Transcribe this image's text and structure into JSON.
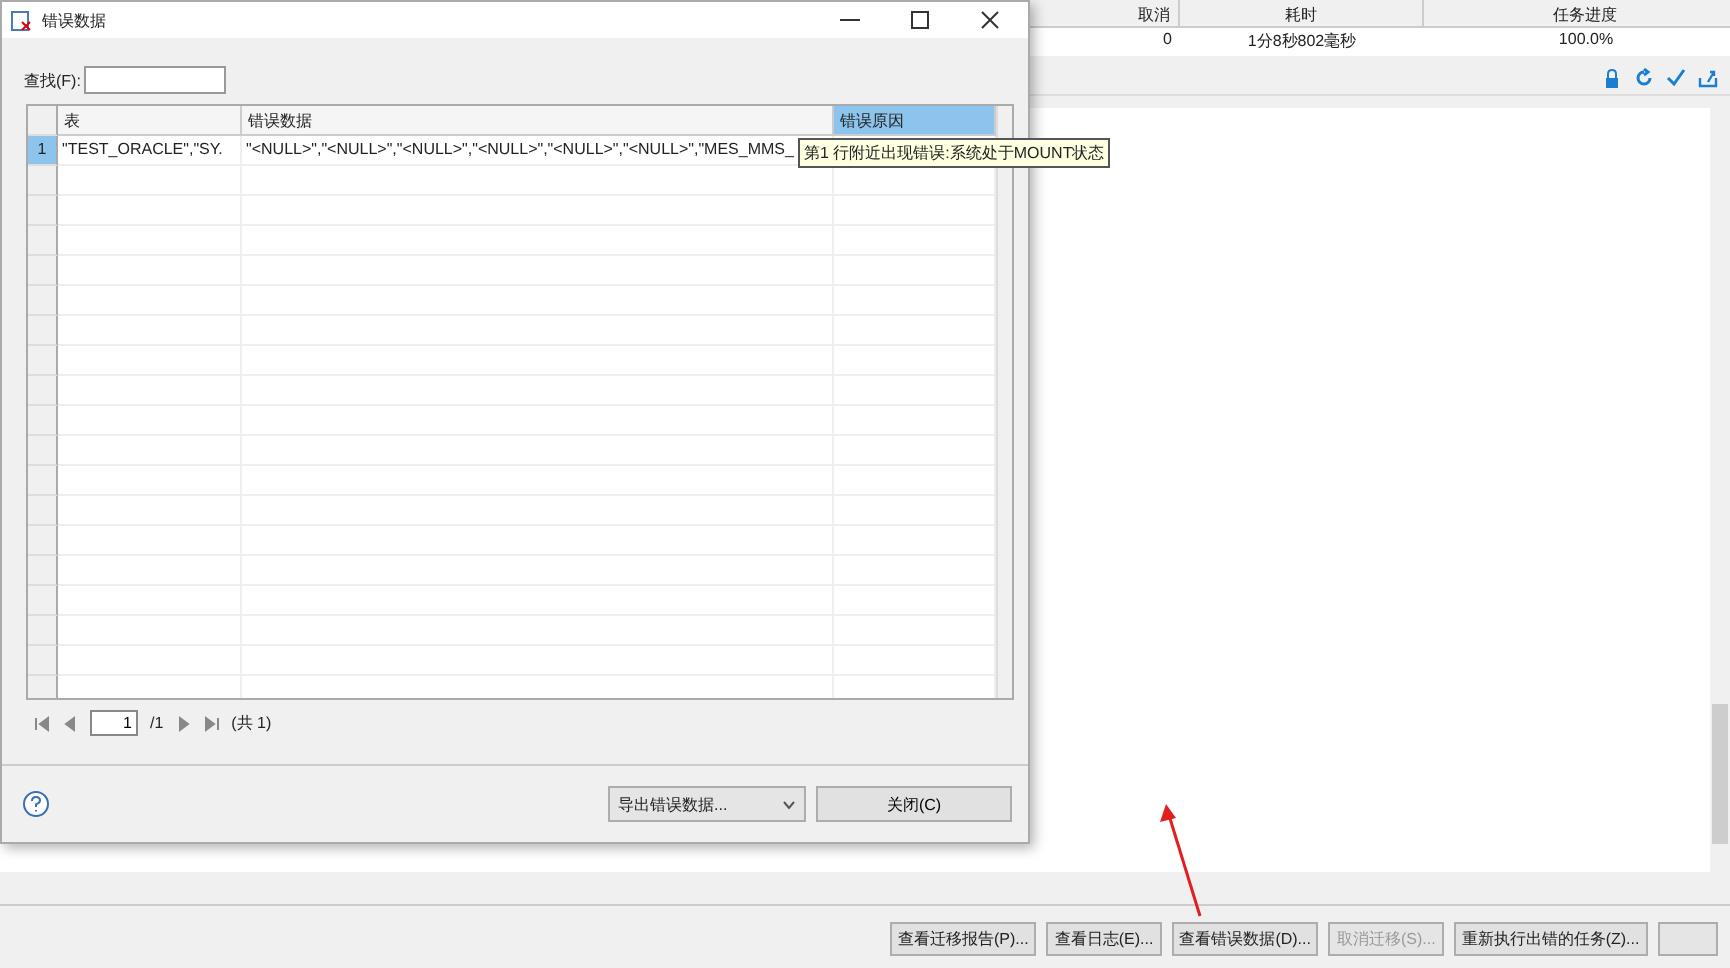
{
  "main_window": {
    "task_table": {
      "columns": [
        "取消",
        "耗时",
        "任务进度"
      ],
      "rows": [
        {
          "cells": [
            "0",
            "1分8秒802毫秒",
            "100.0%"
          ]
        }
      ]
    },
    "buttons": [
      {
        "label": "查看迁移报告(P)...",
        "disabled": false
      },
      {
        "label": "查看日志(E)...",
        "disabled": false
      },
      {
        "label": "查看错误数据(D)...",
        "disabled": false
      },
      {
        "label": "取消迁移(S)...",
        "disabled": true
      },
      {
        "label": "重新执行出错的任务(Z)...",
        "disabled": false
      }
    ]
  },
  "dialog": {
    "title": "错误数据",
    "find_label": "查找(F):",
    "grid": {
      "columns": [
        {
          "label": "表",
          "selected": false
        },
        {
          "label": "错误数据",
          "selected": false
        },
        {
          "label": "错误原因",
          "selected": true
        }
      ],
      "rows": [
        {
          "number": "1",
          "selected": true,
          "cells": [
            "\"TEST_ORACLE\",\"SY.",
            "\"<NULL>\",\"<NULL>\",\"<NULL>\",\"<NULL>\",\"<NULL>\",\"<NULL>\",\"MES_MMS_"
          ]
        }
      ],
      "tooltip": "第1 行附近出现错误:系统处于MOUNT状态"
    },
    "pager": {
      "page": "1",
      "total_pages": "/1",
      "count": "(共 1)"
    },
    "export_select": "导出错误数据...",
    "close_button": "关闭(C)"
  }
}
